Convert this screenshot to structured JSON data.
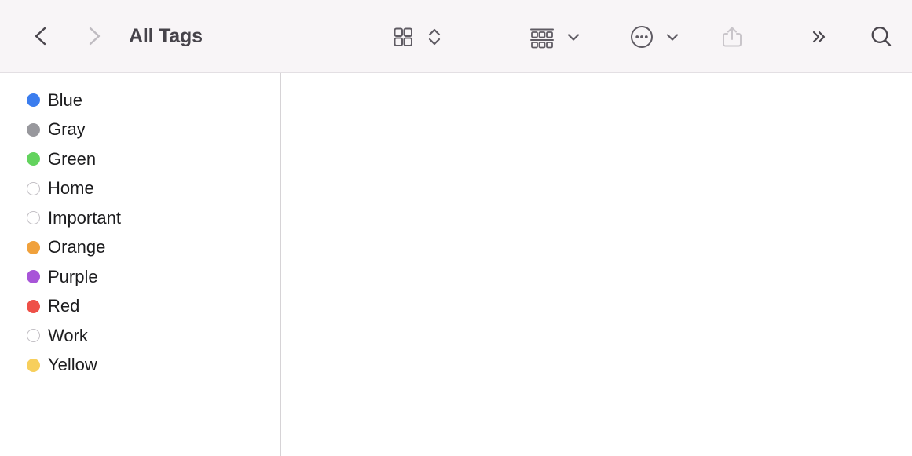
{
  "window": {
    "title": "All Tags"
  },
  "toolbar": {
    "back_label": "Back",
    "forward_label": "Forward",
    "view_grid_label": "Icon View",
    "view_stepper_label": "Change View",
    "group_label": "Group Items",
    "group_chevron_label": "Group Options",
    "actions_label": "More Actions",
    "actions_chevron_label": "More Actions Options",
    "share_label": "Share",
    "overflow_label": "More Toolbar Items",
    "search_label": "Search",
    "background_color": "#f8f5f7",
    "icon_color": "#5f5b63",
    "icon_color_disabled": "#c9c5ca"
  },
  "sidebar": {
    "tags": [
      {
        "label": "Blue",
        "color": "#3b7dee",
        "filled": true
      },
      {
        "label": "Gray",
        "color": "#98989d",
        "filled": true
      },
      {
        "label": "Green",
        "color": "#63d35e",
        "filled": true
      },
      {
        "label": "Home",
        "color": "",
        "filled": false
      },
      {
        "label": "Important",
        "color": "",
        "filled": false
      },
      {
        "label": "Orange",
        "color": "#f0a13c",
        "filled": true
      },
      {
        "label": "Purple",
        "color": "#a855d8",
        "filled": true
      },
      {
        "label": "Red",
        "color": "#ee5048",
        "filled": true
      },
      {
        "label": "Work",
        "color": "",
        "filled": false
      },
      {
        "label": "Yellow",
        "color": "#f7cf5c",
        "filled": true
      }
    ]
  },
  "detail": {
    "empty": ""
  }
}
